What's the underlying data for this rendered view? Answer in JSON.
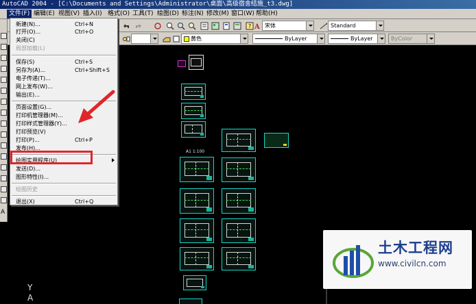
{
  "window": {
    "title": "AutoCAD 2004 - [C:\\Documents and Settings\\Administrator\\桌面\\高级宿舍结施_t3.dwg]"
  },
  "menubar": [
    {
      "label": "文件(F)",
      "active": true
    },
    {
      "label": "编辑(E)"
    },
    {
      "label": "视图(V)"
    },
    {
      "label": "插入(I)"
    },
    {
      "label": "格式(O)"
    },
    {
      "label": "工具(T)"
    },
    {
      "label": "绘图(D)"
    },
    {
      "label": "标注(N)"
    },
    {
      "label": "修改(M)"
    },
    {
      "label": "窗口(W)"
    },
    {
      "label": "帮助(H)"
    }
  ],
  "toolbar": {
    "font_combo": "宋体",
    "style_combo": "Standard",
    "color_combo": "黄色",
    "linetype_combo": "ByLayer",
    "lineweight_combo": "ByLayer",
    "plotstyle_combo": "ByColor"
  },
  "file_menu": {
    "items": [
      {
        "label": "新建(N)...",
        "shortcut": "Ctrl+N"
      },
      {
        "label": "打开(O)...",
        "shortcut": "Ctrl+O"
      },
      {
        "label": "关闭(C)",
        "shortcut": ""
      },
      {
        "label": "局部加载(L)",
        "shortcut": "",
        "disabled": true
      },
      {
        "label": "保存(S)",
        "shortcut": "Ctrl+S"
      },
      {
        "label": "另存为(A)...",
        "shortcut": "Ctrl+Shift+S"
      },
      {
        "label": "电子传递(T)...",
        "shortcut": ""
      },
      {
        "label": "网上发布(W)...",
        "shortcut": ""
      },
      {
        "label": "输出(E)...",
        "shortcut": ""
      },
      {
        "label": "页面设置(G)...",
        "shortcut": ""
      },
      {
        "label": "打印机管理器(M)...",
        "shortcut": ""
      },
      {
        "label": "打印样式管理器(Y)...",
        "shortcut": ""
      },
      {
        "label": "打印预览(V)",
        "shortcut": ""
      },
      {
        "label": "打印(P)...",
        "shortcut": "Ctrl+P"
      },
      {
        "label": "发布(H)...",
        "shortcut": ""
      },
      {
        "label": "绘图实用程序(U)",
        "shortcut": "",
        "submenu": true
      },
      {
        "label": "发送(D)...",
        "shortcut": ""
      },
      {
        "label": "图形特性(I)...",
        "shortcut": ""
      },
      {
        "label": "绘图历史",
        "shortcut": "",
        "disabled": true
      },
      {
        "label": "退出(X)",
        "shortcut": "Ctrl+Q"
      }
    ]
  },
  "drawing": {
    "label_a1": "A1 1:100",
    "ucs_y": "Y",
    "ucs_a": "A"
  },
  "watermark": {
    "title": "土木工程网",
    "url": "www.civilcn.com"
  },
  "colors": {
    "accent_sheet": "#19d7c8",
    "highlight_red": "#e0262a",
    "arrow_red": "#e0262a"
  }
}
